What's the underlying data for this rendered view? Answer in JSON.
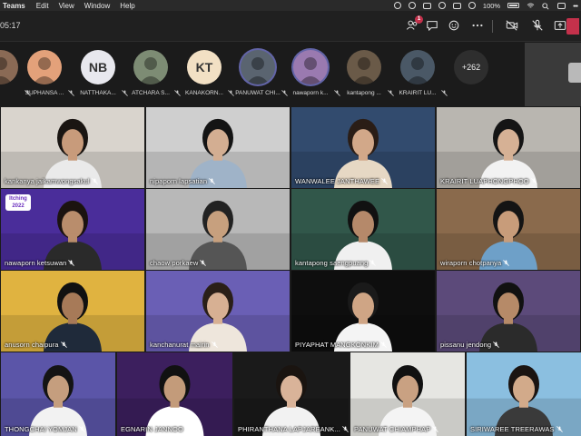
{
  "menubar": {
    "app": "Teams",
    "items": [
      "Edit",
      "View",
      "Window",
      "Help"
    ],
    "battery": "100%"
  },
  "toolbar": {
    "timer": "05:17",
    "people_badge": "1"
  },
  "strip": {
    "participants": [
      {
        "name": "",
        "initials": "",
        "color": "#8a6a55"
      },
      {
        "name": "SUPHANSA ...",
        "initials": "",
        "color": "#e3a17a"
      },
      {
        "name": "NATTHAKA...",
        "initials": "NB",
        "color": "#e8e8ee"
      },
      {
        "name": "ATCHARA S...",
        "initials": "",
        "color": "#7d8c74"
      },
      {
        "name": "KANAKORN...",
        "initials": "KT",
        "color": "#f2e0c4"
      },
      {
        "name": "PANUWAT CHI...",
        "initials": "",
        "color": "#5a6470"
      },
      {
        "name": "nawaporn k...",
        "initials": "",
        "color": "#9a7ab0"
      },
      {
        "name": "kantapong ...",
        "initials": "",
        "color": "#6a5a48"
      },
      {
        "name": "KRAIRIT LU...",
        "initials": "",
        "color": "#4a5866"
      }
    ],
    "more_count": "+262"
  },
  "tiles": [
    {
      "name": "kankanya jaikamwongsakul",
      "bg": "#d9d4cd",
      "skin": "#c89b7b",
      "hair": "#1a1512",
      "shirt": "#eaeaea"
    },
    {
      "name": "nipaporn lapsatian",
      "bg": "#cfcfcf",
      "skin": "#d3ae92",
      "hair": "#141414",
      "shirt": "#9fb3c8"
    },
    {
      "name": "WANWALEE JANTHAWEE",
      "bg": "#324b6e",
      "skin": "#d2a889",
      "hair": "#2a1d16",
      "shirt": "#e6d8c4"
    },
    {
      "name": "KRAIRIT LUAPHONGPHOO",
      "bg": "#b9b6b0",
      "skin": "#d6b195",
      "hair": "#151515",
      "shirt": "#f2f2f2"
    },
    {
      "name": "nawaporn ketsuwan",
      "bg": "#4a2d9a",
      "skin": "#b98d6c",
      "hair": "#1b1310",
      "shirt": "#2a2a2a",
      "badge": "Itching 2022"
    },
    {
      "name": "chaow porkaew",
      "bg": "#b8b8b8",
      "skin": "#c7a07e",
      "hair": "#222",
      "shirt": "#555"
    },
    {
      "name": "kantapong saengpuang",
      "bg": "#31574a",
      "skin": "#b5896a",
      "hair": "#111",
      "shirt": "#f0f0f0"
    },
    {
      "name": "wiraporn chotpanya",
      "bg": "#8a6a4c",
      "skin": "#c89c7a",
      "hair": "#141414",
      "shirt": "#6ea0c8"
    },
    {
      "name": "anusorn chaipura",
      "bg": "#e0b340",
      "skin": "#a77a58",
      "hair": "#111",
      "shirt": "#1f2a3a"
    },
    {
      "name": "kanchanurat mairin",
      "bg": "#6a5fb5",
      "skin": "#d7b093",
      "hair": "#2a1f18",
      "shirt": "#eee6dc"
    },
    {
      "name": "PIYAPHAT MANGKONKIM",
      "bg": "#0e0e0e",
      "skin": "#cfa585",
      "hair": "#1a1a1a",
      "shirt": "#f4f4f4"
    },
    {
      "name": "pissanu jendong",
      "bg": "#5c4a7a",
      "skin": "#b68a68",
      "hair": "#111",
      "shirt": "#2b2b2b"
    },
    {
      "name": "THONGCHAI YOMJAN",
      "bg": "#5b55a8",
      "skin": "#c59e7e",
      "hair": "#141414",
      "shirt": "#f2f2f2"
    },
    {
      "name": "EGNARIN JANNOO",
      "bg": "#3c1f5e",
      "skin": "#c39b7a",
      "hair": "#111",
      "shirt": "#ffffff"
    },
    {
      "name": "PHIRANTHANA LAPJAREANK...",
      "bg": "#1a1a1a",
      "skin": "#d9b399",
      "hair": "#1a1410",
      "shirt": "#f2f2f2"
    },
    {
      "name": "PANUWAT CHIAMPHAP",
      "bg": "#e6e6e2",
      "skin": "#c9a182",
      "hair": "#111",
      "shirt": "#f4f4f4"
    },
    {
      "name": "SIRIWAREE TREERAWAS",
      "bg": "#8bbfe0",
      "skin": "#d2aa8a",
      "hair": "#1b1411",
      "shirt": "#3a3a3a"
    }
  ]
}
